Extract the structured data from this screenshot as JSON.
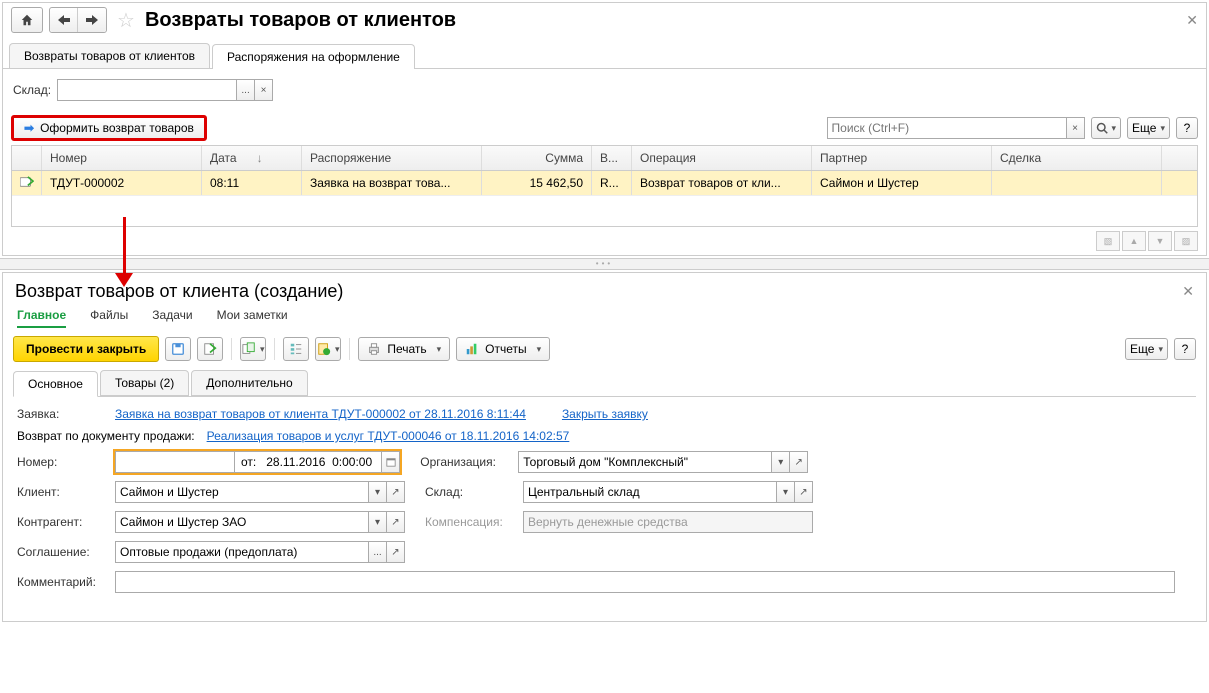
{
  "topPanel": {
    "pageTitle": "Возвраты товаров от клиентов",
    "tabs": [
      "Возвраты товаров от клиентов",
      "Распоряжения на оформление"
    ],
    "activeTab": 1,
    "filterLabel": "Склад:",
    "actionBtn": "Оформить возврат товаров",
    "searchPlaceholder": "Поиск (Ctrl+F)",
    "moreBtn": "Еще",
    "helpBtn": "?",
    "columns": {
      "num": "Номер",
      "date": "Дата",
      "rasp": "Распоряжение",
      "sum": "Сумма",
      "v": "В...",
      "op": "Операция",
      "part": "Партнер",
      "sd": "Сделка"
    },
    "rows": [
      {
        "num": "ТДУТ-000002",
        "date": "08:11",
        "rasp": "Заявка на возврат това...",
        "sum": "15 462,50",
        "v": "R...",
        "op": "Возврат товаров от кли...",
        "part": "Саймон и Шустер",
        "sd": ""
      }
    ]
  },
  "bottomPanel": {
    "title": "Возврат товаров от клиента (создание)",
    "menu": [
      "Главное",
      "Файлы",
      "Задачи",
      "Мои заметки"
    ],
    "activeMenu": 0,
    "mainActionBtn": "Провести и закрыть",
    "printBtn": "Печать",
    "reportsBtn": "Отчеты",
    "moreBtn": "Еще",
    "helpBtn": "?",
    "tabs": [
      "Основное",
      "Товары (2)",
      "Дополнительно"
    ],
    "activeTab": 0,
    "form": {
      "zayavkaLabel": "Заявка:",
      "zayavkaLink": "Заявка на возврат товаров от клиента ТДУТ-000002 от 28.11.2016 8:11:44",
      "closeZayavkaLink": "Закрыть заявку",
      "vozvratDocLabel": "Возврат по документу продажи:",
      "vozvratDocLink": "Реализация товаров и услуг ТДУТ-000046 от 18.11.2016 14:02:57",
      "numLabel": "Номер:",
      "fromLabel": "от:",
      "dateValue": "28.11.2016  0:00:00",
      "orgLabel": "Организация:",
      "orgValue": "Торговый дом \"Комплексный\"",
      "clientLabel": "Клиент:",
      "clientValue": "Саймон и Шустер",
      "skladLabel": "Склад:",
      "skladValue": "Центральный склад",
      "contragentLabel": "Контрагент:",
      "contragentValue": "Саймон и Шустер ЗАО",
      "kompLabel": "Компенсация:",
      "kompValue": "Вернуть денежные средства",
      "soglLabel": "Соглашение:",
      "soglValue": "Оптовые продажи (предоплата)",
      "commentLabel": "Комментарий:"
    }
  }
}
